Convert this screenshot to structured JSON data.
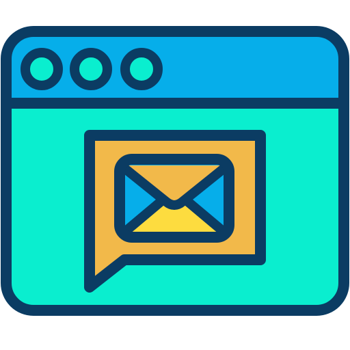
{
  "icon": {
    "name": "browser-window-email-message-icon",
    "colors": {
      "outline": "#0b3c63",
      "title_bar": "#06aeea",
      "window_body": "#0aeecf",
      "dot_fill": "#0aeecf",
      "bubble": "#f2b94a",
      "envelope_sides": "#06aeea",
      "envelope_bottom": "#fddc3f"
    },
    "window_control_dots": 3
  }
}
